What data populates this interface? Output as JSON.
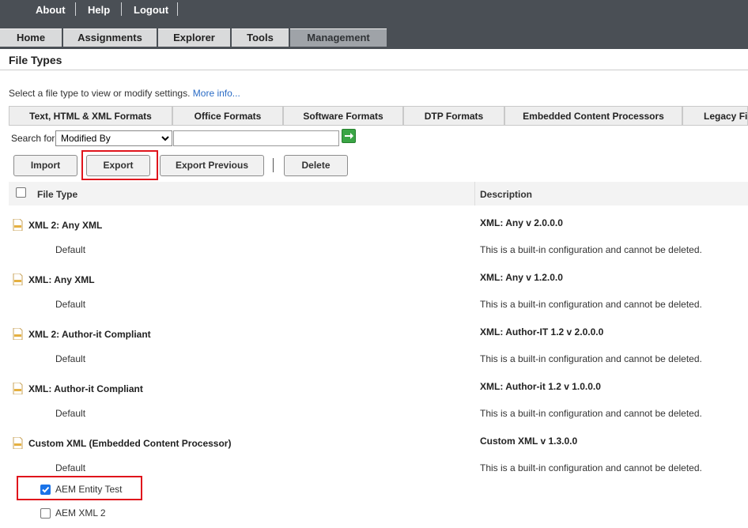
{
  "topnav": {
    "links": [
      "About",
      "Help",
      "Logout"
    ]
  },
  "mainnav": {
    "tabs": [
      "Home",
      "Assignments",
      "Explorer",
      "Tools",
      "Management"
    ],
    "active": "Management"
  },
  "page": {
    "title": "File Types",
    "intro": "Select a file type to view or modify settings.",
    "more_link": "More info..."
  },
  "format_tabs": [
    "Text, HTML & XML Formats",
    "Office Formats",
    "Software Formats",
    "DTP Formats",
    "Embedded Content Processors",
    "Legacy File"
  ],
  "search": {
    "label": "Search for:",
    "selected": "Modified By",
    "value": ""
  },
  "toolbar": {
    "import": "Import",
    "export": "Export",
    "export_previous": "Export Previous",
    "delete": "Delete"
  },
  "table": {
    "headers": {
      "file_type": "File Type",
      "description": "Description"
    },
    "rows": [
      {
        "name": "XML 2: Any XML",
        "version": "XML: Any v 2.0.0.0",
        "sub": "Default",
        "sub_desc": "This is a built-in configuration and cannot be deleted."
      },
      {
        "name": "XML: Any XML",
        "version": "XML: Any v 1.2.0.0",
        "sub": "Default",
        "sub_desc": "This is a built-in configuration and cannot be deleted."
      },
      {
        "name": "XML 2: Author-it Compliant",
        "version": "XML: Author-IT 1.2 v 2.0.0.0",
        "sub": "Default",
        "sub_desc": "This is a built-in configuration and cannot be deleted."
      },
      {
        "name": "XML: Author-it Compliant",
        "version": "XML: Author-it 1.2 v 1.0.0.0",
        "sub": "Default",
        "sub_desc": "This is a built-in configuration and cannot be deleted."
      },
      {
        "name": "Custom XML (Embedded Content Processor)",
        "version": "Custom XML v 1.3.0.0",
        "sub": "Default",
        "sub_desc": "This is a built-in configuration and cannot be deleted."
      }
    ],
    "custom_items": [
      {
        "name": "AEM Entity Test",
        "checked": true
      },
      {
        "name": "AEM XML 2",
        "checked": false
      }
    ]
  },
  "colors": {
    "topbar": "#4a4f55",
    "highlight": "#e0141c",
    "link": "#2a6bc5",
    "go": "#3aa545"
  }
}
